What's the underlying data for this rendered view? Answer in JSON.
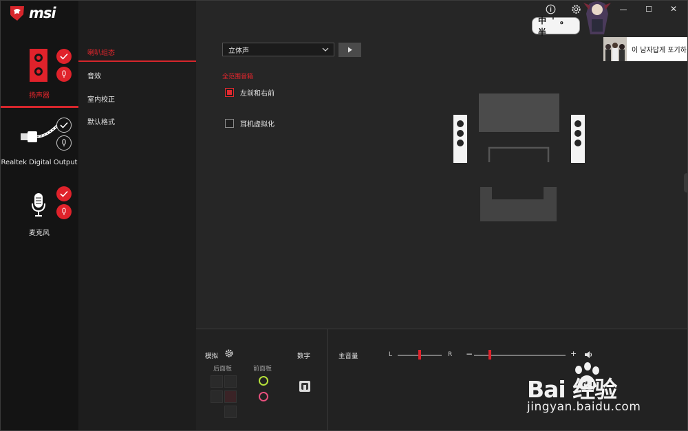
{
  "app": {
    "brand": "msi"
  },
  "titlebar": {
    "info_icon": "info-icon",
    "settings_icon": "gear-icon",
    "minimize_glyph": "—",
    "maximize_glyph": "☐",
    "close_glyph": "✕"
  },
  "devices": [
    {
      "label": "扬声器",
      "icon": "speaker-icon",
      "active": true
    },
    {
      "label": "Realtek Digital Output",
      "icon": "digital-cable-icon",
      "active": false
    },
    {
      "label": "麦克风",
      "icon": "microphone-icon",
      "active": false
    }
  ],
  "menu": {
    "items": [
      {
        "label": "喇叭组态",
        "active": true
      },
      {
        "label": "音效",
        "active": false
      },
      {
        "label": "室内校正",
        "active": false
      },
      {
        "label": "默认格式",
        "active": false
      }
    ]
  },
  "config": {
    "speaker_mode": "立体声",
    "fullrange_title": "全范围音箱",
    "front_lr_label": "左前和右前",
    "front_lr_checked": true,
    "headphone_virt_label": "耳机虚拟化",
    "headphone_virt_checked": false
  },
  "bottom": {
    "analog_label": "模拟",
    "rear_panel_label": "后面板",
    "front_panel_label": "前面板",
    "digital_label": "数字",
    "main_volume_label": "主音量",
    "balance_left": "L",
    "balance_right": "R",
    "volume_minus": "−",
    "volume_plus": "+",
    "balance_value": 0.5,
    "volume_value": 0.17
  },
  "overlays": {
    "ime_text": "中 ' 。半",
    "notification_text": "이 남자답게 포기하"
  },
  "watermark": {
    "brand": "Bai 经验",
    "url": "jingyan.baidu.com"
  },
  "colors": {
    "accent": "#e0222b",
    "bg": "#262626",
    "sidebar": "#141414",
    "menu": "#1d1d1d",
    "jack_green": "#b7e23a",
    "jack_pink": "#e8507d"
  }
}
